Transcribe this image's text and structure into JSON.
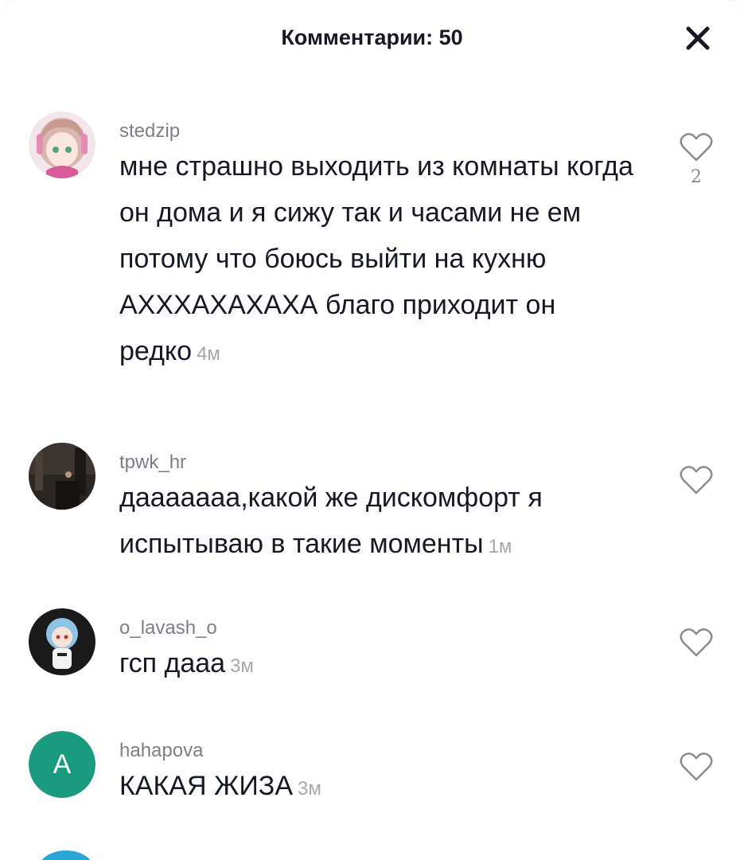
{
  "header": {
    "title": "Комментарии: 50"
  },
  "comments": [
    {
      "username": "stedzip",
      "text": "мне страшно выходить из комнаты когда он дома и я сижу так и часами не ем потому что боюсь выйти на кухню АХХХАХАХАХА благо приходит он редко",
      "time": "4м",
      "likes": "2",
      "avatar": "anime-girl-avatar"
    },
    {
      "username": "tpwk_hr",
      "text": "дааааааа,какой же дискомфорт я испытываю в такие моменты",
      "time": "1м",
      "likes": "",
      "avatar": "dark-photo-avatar"
    },
    {
      "username": "o_lavash_o",
      "text": "гсп дааа",
      "time": "3м",
      "likes": "",
      "avatar": "anime-figure-avatar"
    },
    {
      "username": "hahapova",
      "text": "КАКАЯ ЖИЗА",
      "time": "3м",
      "likes": "",
      "avatar_letter": "A",
      "avatar_color": "#1a9a7e"
    }
  ],
  "icons": {
    "close": "close-icon",
    "like": "heart-outline-icon"
  }
}
